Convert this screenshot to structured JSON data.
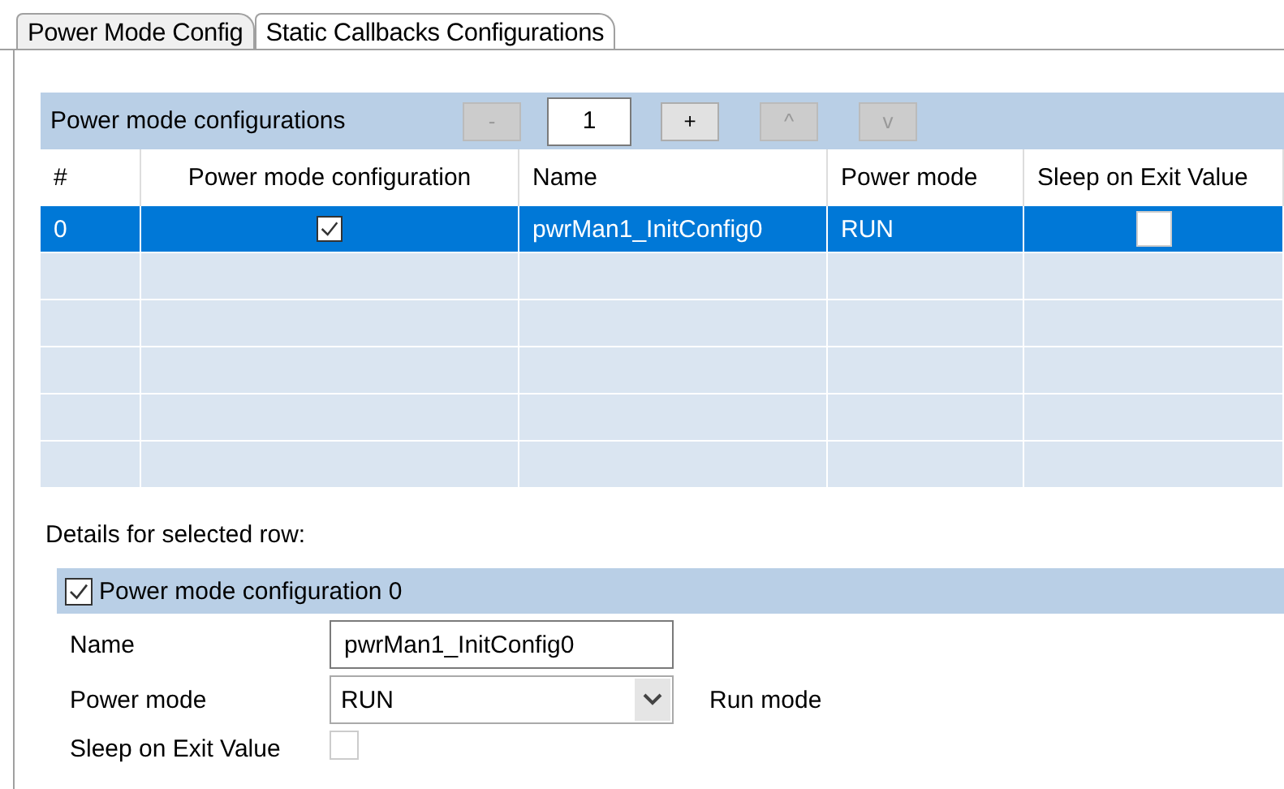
{
  "tabs": [
    {
      "label": "Power Mode Config",
      "selected": true
    },
    {
      "label": "Static Callbacks Configurations",
      "selected": false
    }
  ],
  "configurations": {
    "title": "Power mode configurations",
    "count": "1",
    "buttons": [
      {
        "label": "-",
        "disabled": true
      },
      {
        "label": "+",
        "disabled": false
      },
      {
        "label": "^",
        "disabled": true
      },
      {
        "label": "v",
        "disabled": true
      }
    ],
    "columns": [
      "#",
      "Power mode configuration",
      "Name",
      "Power mode",
      "Sleep on Exit Value"
    ],
    "rows": [
      {
        "index": "0",
        "enabled": true,
        "name": "pwrMan1_InitConfig0",
        "power_mode": "RUN",
        "sleep_on_exit": false,
        "selected": true
      }
    ]
  },
  "details": {
    "label": "Details for selected row:",
    "group_title": "Power mode configuration 0",
    "group_checked": true,
    "name_label": "Name",
    "name_value": "pwrMan1_InitConfig0",
    "mode_label": "Power mode",
    "mode_value": "RUN",
    "mode_hint": "Run mode",
    "sleep_label": "Sleep on Exit Value",
    "sleep_checked": false,
    "sleep_disabled": true
  }
}
